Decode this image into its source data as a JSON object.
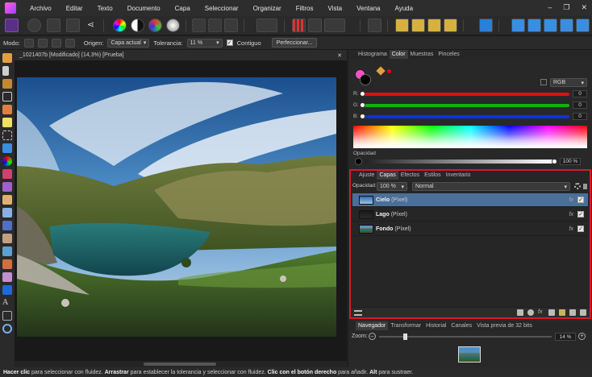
{
  "menubar": {
    "items": [
      "Archivo",
      "Editar",
      "Texto",
      "Documento",
      "Capa",
      "Seleccionar",
      "Organizar",
      "Filtros",
      "Vista",
      "Ventana",
      "Ayuda"
    ],
    "window_controls": [
      "–",
      "❐",
      "✕"
    ]
  },
  "context_toolbar": {
    "mode_label": "Modo:",
    "origin_label": "Origen:",
    "origin_value": "Capa actual",
    "tolerance_label": "Tolerancia:",
    "tolerance_value": "11 %",
    "contiguous_label": "Contiguo",
    "contiguous_checked": "✓",
    "refine_label": "Perfeccionar..."
  },
  "document": {
    "tab_title": "_1021407b [Modificado] (14,3%) [Prueba]",
    "close": "✕"
  },
  "color_panel": {
    "tabs": [
      "Histograma",
      "Color",
      "Muestras",
      "Pinceles"
    ],
    "active_tab": "Color",
    "model": "RGB",
    "sliders": [
      {
        "label": "R:",
        "value": "0",
        "color": "#e01010"
      },
      {
        "label": "G:",
        "value": "0",
        "color": "#10b010"
      },
      {
        "label": "B:",
        "value": "0",
        "color": "#1030e0"
      }
    ],
    "opacity_label": "Opacidad",
    "opacity_value": "100 %",
    "primary_color": "#000000",
    "secondary_color": "#ff4fc8"
  },
  "layers_panel": {
    "tabs": [
      "Ajuste",
      "Capas",
      "Efectos",
      "Estilos",
      "Inventario"
    ],
    "active_tab": "Capas",
    "opacity_label": "Opacidad:",
    "opacity_value": "100 %",
    "blend_mode": "Normal",
    "layers": [
      {
        "name": "Cielo",
        "type": "(Píxel)",
        "selected": true
      },
      {
        "name": "Lago",
        "type": "(Píxel)",
        "selected": false
      },
      {
        "name": "Fondo",
        "type": "(Píxel)",
        "selected": false
      }
    ],
    "fx_label": "fx",
    "check_mark": "✓"
  },
  "navigator_panel": {
    "tabs": [
      "Navegador",
      "Transformar",
      "Historial",
      "Canales",
      "Vista previa de 32 bits"
    ],
    "active_tab": "Navegador",
    "zoom_label": "Zoom:",
    "zoom_value": "14 %",
    "zoom_level": 0.14
  },
  "status": {
    "parts": [
      {
        "bold": true,
        "text": "Hacer clic"
      },
      {
        "bold": false,
        "text": " para seleccionar con fluidez. "
      },
      {
        "bold": true,
        "text": "Arrastrar"
      },
      {
        "bold": false,
        "text": " para establecer la tolerancia y seleccionar con fluidez. "
      },
      {
        "bold": true,
        "text": "Clic con el botón derecho"
      },
      {
        "bold": false,
        "text": " para añadir. "
      },
      {
        "bold": true,
        "text": "Alt"
      },
      {
        "bold": false,
        "text": " para sustraer."
      }
    ]
  },
  "colors": {
    "accent": "#d11c2a",
    "selection": "#4a6f98",
    "persona": "#5a2f86"
  }
}
